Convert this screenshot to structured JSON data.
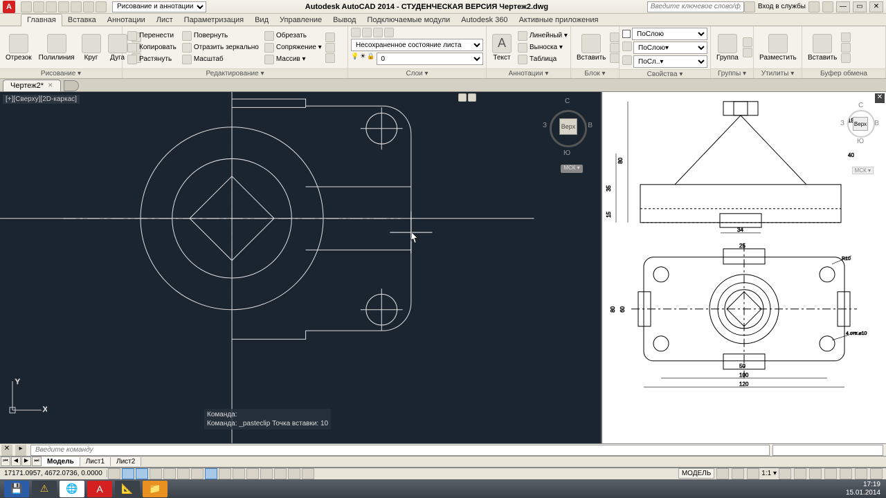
{
  "title": "Autodesk AutoCAD 2014 - СТУДЕНЧЕСКАЯ ВЕРСИЯ   Чертеж2.dwg",
  "workspace": "Рисование и аннотации",
  "search_placeholder": "Введите ключевое слово/фразу",
  "signin": "Вход в службы",
  "tabs": {
    "t0": "Главная",
    "t1": "Вставка",
    "t2": "Аннотации",
    "t3": "Лист",
    "t4": "Параметризация",
    "t5": "Вид",
    "t6": "Управление",
    "t7": "Вывод",
    "t8": "Подключаемые модули",
    "t9": "Autodesk 360",
    "t10": "Активные приложения"
  },
  "ribbon": {
    "draw": {
      "title": "Рисование ▾",
      "line": "Отрезок",
      "polyline": "Полилиния",
      "circle": "Круг",
      "arc": "Дуга"
    },
    "modify": {
      "title": "Редактирование ▾",
      "move": "Перенести",
      "copy": "Копировать",
      "stretch": "Растянуть",
      "rotate": "Повернуть",
      "mirror": "Отразить зеркально",
      "scale": "Масштаб",
      "trim": "Обрезать",
      "fillet": "Сопряжение ▾",
      "array": "Массив ▾"
    },
    "layers": {
      "title": "Слои ▾",
      "state": "Несохраненное состояние листа"
    },
    "annot": {
      "title": "Аннотации ▾",
      "text": "Текст",
      "linear": "Линейный ▾",
      "leader": "Выноска ▾",
      "table": "Таблица"
    },
    "block": {
      "title": "Блок ▾",
      "insert": "Вставить"
    },
    "props": {
      "title": "Свойства ▾",
      "bylayer": "ПоСлою",
      "bylayer2": "ПоСлою▾",
      "bylayer3": "ПоСл..▾"
    },
    "groups": {
      "title": "Группы ▾",
      "group": "Группа"
    },
    "utils": {
      "title": "Утилиты ▾",
      "measure": "Разместить"
    },
    "clip": {
      "title": "Буфер обмена",
      "paste": "Вставить"
    }
  },
  "doc": {
    "tab": "Чертеж2*"
  },
  "view": {
    "label": "[+][Сверху][2D-каркас]",
    "cube": {
      "top": "Верх",
      "n": "С",
      "s": "Ю",
      "e": "В",
      "w": "З",
      "wcs": "МСК ▾"
    }
  },
  "cmd": {
    "h1": "Команда:",
    "h2": "Команда: _pasteclip Точка вставки: 10",
    "placeholder": "Введите команду"
  },
  "layout": {
    "model": "Модель",
    "l1": "Лист1",
    "l2": "Лист2"
  },
  "status": {
    "coords": "17171.0957, 4672.0736, 0.0000",
    "model_btn": "МОДЕЛЬ",
    "scale": "1:1 ▾"
  },
  "taskbar": {
    "time": "17:19",
    "date": "15.01.2014"
  }
}
